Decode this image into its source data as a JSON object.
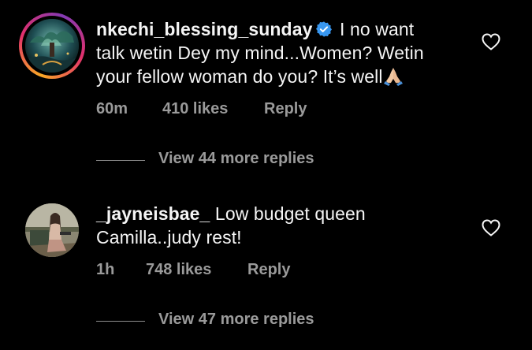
{
  "comments": [
    {
      "username": "nkechi_blessing_sunday",
      "verified": true,
      "text_line1": "I no want",
      "text_line2": "talk wetin Dey my mind...Women? Wetin",
      "text_line3": "your fellow woman do you? It’s well",
      "time": "60m",
      "likes": "410 likes",
      "reply_label": "Reply",
      "view_replies": "View 44 more replies",
      "avatar_icon": "avatar-fantasy-landscape",
      "ring_colors": [
        "#f9a825",
        "#e1306c",
        "#833ab4"
      ]
    },
    {
      "username": "_jayneisbae_",
      "verified": false,
      "text_line1": "Low budget queen",
      "text_line2": "Camilla..judy rest!",
      "time": "1h",
      "likes": "748 likes",
      "reply_label": "Reply",
      "view_replies": "View 47 more replies",
      "avatar_icon": "avatar-photo-woman"
    }
  ],
  "colors": {
    "background": "#000000",
    "text": "#f5f5f5",
    "meta": "#9a9a9a",
    "verified_badge": "#3897f0"
  }
}
